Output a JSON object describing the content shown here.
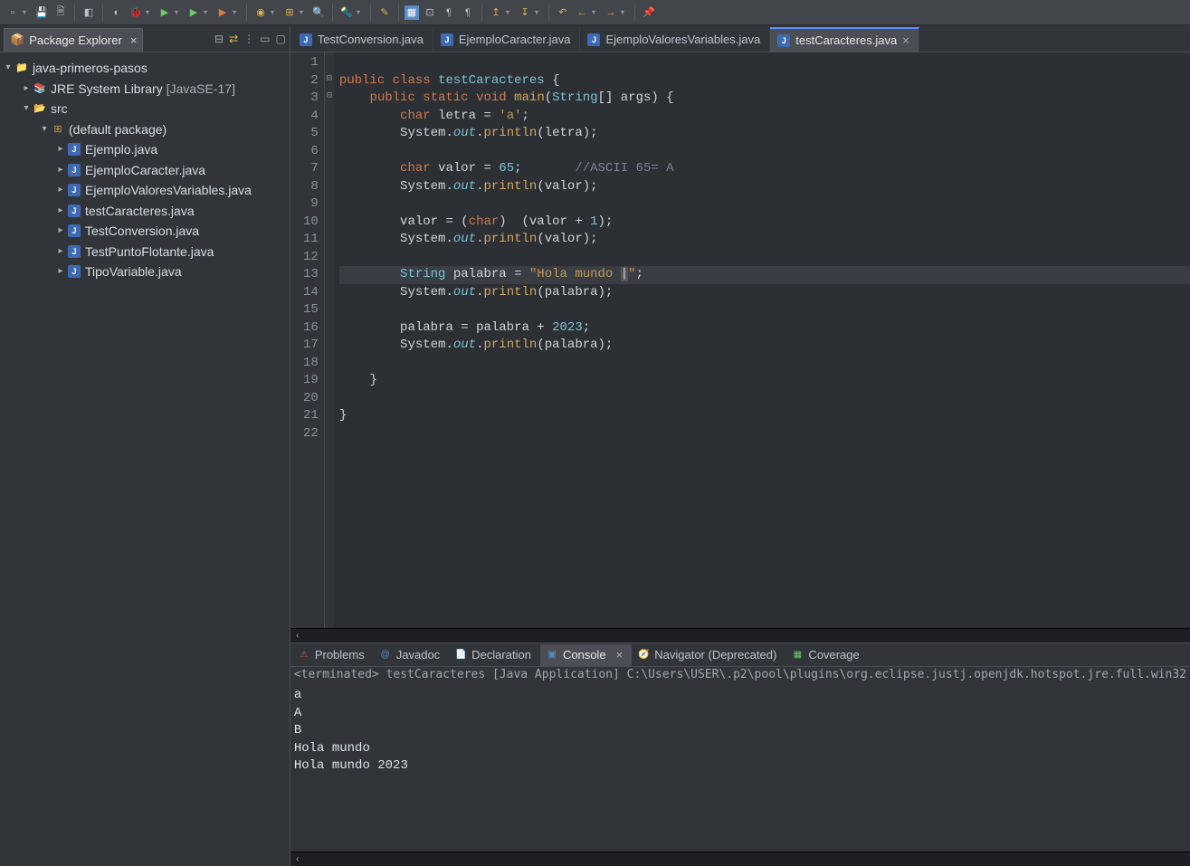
{
  "sidebar": {
    "title": "Package Explorer",
    "project": "java-primeros-pasos",
    "jre": "JRE System Library",
    "jre_ver": "[JavaSE-17]",
    "src": "src",
    "pkg": "(default package)",
    "files": [
      "Ejemplo.java",
      "EjemploCaracter.java",
      "EjemploValoresVariables.java",
      "testCaracteres.java",
      "TestConversion.java",
      "TestPuntoFlotante.java",
      "TipoVariable.java"
    ]
  },
  "editor_tabs": [
    "TestConversion.java",
    "EjemploCaracter.java",
    "EjemploValoresVariables.java",
    "testCaracteres.java"
  ],
  "editor_active_index": 3,
  "code": {
    "lines": [
      {
        "n": 1,
        "html": ""
      },
      {
        "n": 2,
        "html": "<span class='kw'>public</span> <span class='kw'>class</span> <span class='cname'>testCaracteres</span> <span class='punct'>{</span>"
      },
      {
        "n": 3,
        "html": "    <span class='kw'>public</span> <span class='kw'>static</span> <span class='kw'>void</span> <span class='mtd'>main</span><span class='punct'>(</span><span class='type'>String</span><span class='punct'>[]</span> <span class='var'>args</span><span class='punct'>) {</span>"
      },
      {
        "n": 4,
        "html": "        <span class='kw'>char</span> <span class='var'>letra</span> <span class='punct'>=</span> <span class='str'>'a'</span><span class='punct'>;</span>"
      },
      {
        "n": 5,
        "html": "        <span class='var'>System</span><span class='punct'>.</span><span class='italic type'>out</span><span class='punct'>.</span><span class='mtd'>println</span><span class='punct'>(</span><span class='var'>letra</span><span class='punct'>);</span>"
      },
      {
        "n": 6,
        "html": ""
      },
      {
        "n": 7,
        "html": "        <span class='kw'>char</span> <span class='var'>valor</span> <span class='punct'>=</span> <span class='num'>65</span><span class='punct'>;</span>       <span class='com'>//ASCII 65= A</span>"
      },
      {
        "n": 8,
        "html": "        <span class='var'>System</span><span class='punct'>.</span><span class='italic type'>out</span><span class='punct'>.</span><span class='mtd'>println</span><span class='punct'>(</span><span class='var'>valor</span><span class='punct'>);</span>"
      },
      {
        "n": 9,
        "html": ""
      },
      {
        "n": 10,
        "html": "        <span class='var'>valor</span> <span class='punct'>= (</span><span class='kw'>char</span><span class='punct'>)  (</span><span class='var'>valor</span> <span class='punct'>+</span> <span class='num'>1</span><span class='punct'>);</span>"
      },
      {
        "n": 11,
        "html": "        <span class='var'>System</span><span class='punct'>.</span><span class='italic type'>out</span><span class='punct'>.</span><span class='mtd'>println</span><span class='punct'>(</span><span class='var'>valor</span><span class='punct'>);</span>"
      },
      {
        "n": 12,
        "html": ""
      },
      {
        "n": 13,
        "hl": true,
        "html": "        <span class='type'>String</span> <span class='var'>palabra</span> <span class='punct'>=</span> <span class='str'>\"Hola mundo </span><span class='punct' style='background:#555;'>|</span><span class='str'>\"</span><span class='punct'>;</span>"
      },
      {
        "n": 14,
        "html": "        <span class='var'>System</span><span class='punct'>.</span><span class='italic type'>out</span><span class='punct'>.</span><span class='mtd'>println</span><span class='punct'>(</span><span class='var'>palabra</span><span class='punct'>);</span>"
      },
      {
        "n": 15,
        "html": ""
      },
      {
        "n": 16,
        "html": "        <span class='var'>palabra</span> <span class='punct'>=</span> <span class='var'>palabra</span> <span class='punct'>+</span> <span class='num'>2023</span><span class='punct'>;</span>"
      },
      {
        "n": 17,
        "html": "        <span class='var'>System</span><span class='punct'>.</span><span class='italic type'>out</span><span class='punct'>.</span><span class='mtd'>println</span><span class='punct'>(</span><span class='var'>palabra</span><span class='punct'>);</span>"
      },
      {
        "n": 18,
        "html": ""
      },
      {
        "n": 19,
        "html": "    <span class='punct'>}</span>"
      },
      {
        "n": 20,
        "html": ""
      },
      {
        "n": 21,
        "html": "<span class='punct'>}</span>"
      },
      {
        "n": 22,
        "html": ""
      }
    ]
  },
  "bottom_tabs": [
    "Problems",
    "Javadoc",
    "Declaration",
    "Console",
    "Navigator (Deprecated)",
    "Coverage"
  ],
  "bottom_active_index": 3,
  "console": {
    "status": "<terminated> testCaracteres [Java Application] C:\\Users\\USER\\.p2\\pool\\plugins\\org.eclipse.justj.openjdk.hotspot.jre.full.win32",
    "output": "a\nA\nB\nHola mundo \nHola mundo 2023"
  }
}
